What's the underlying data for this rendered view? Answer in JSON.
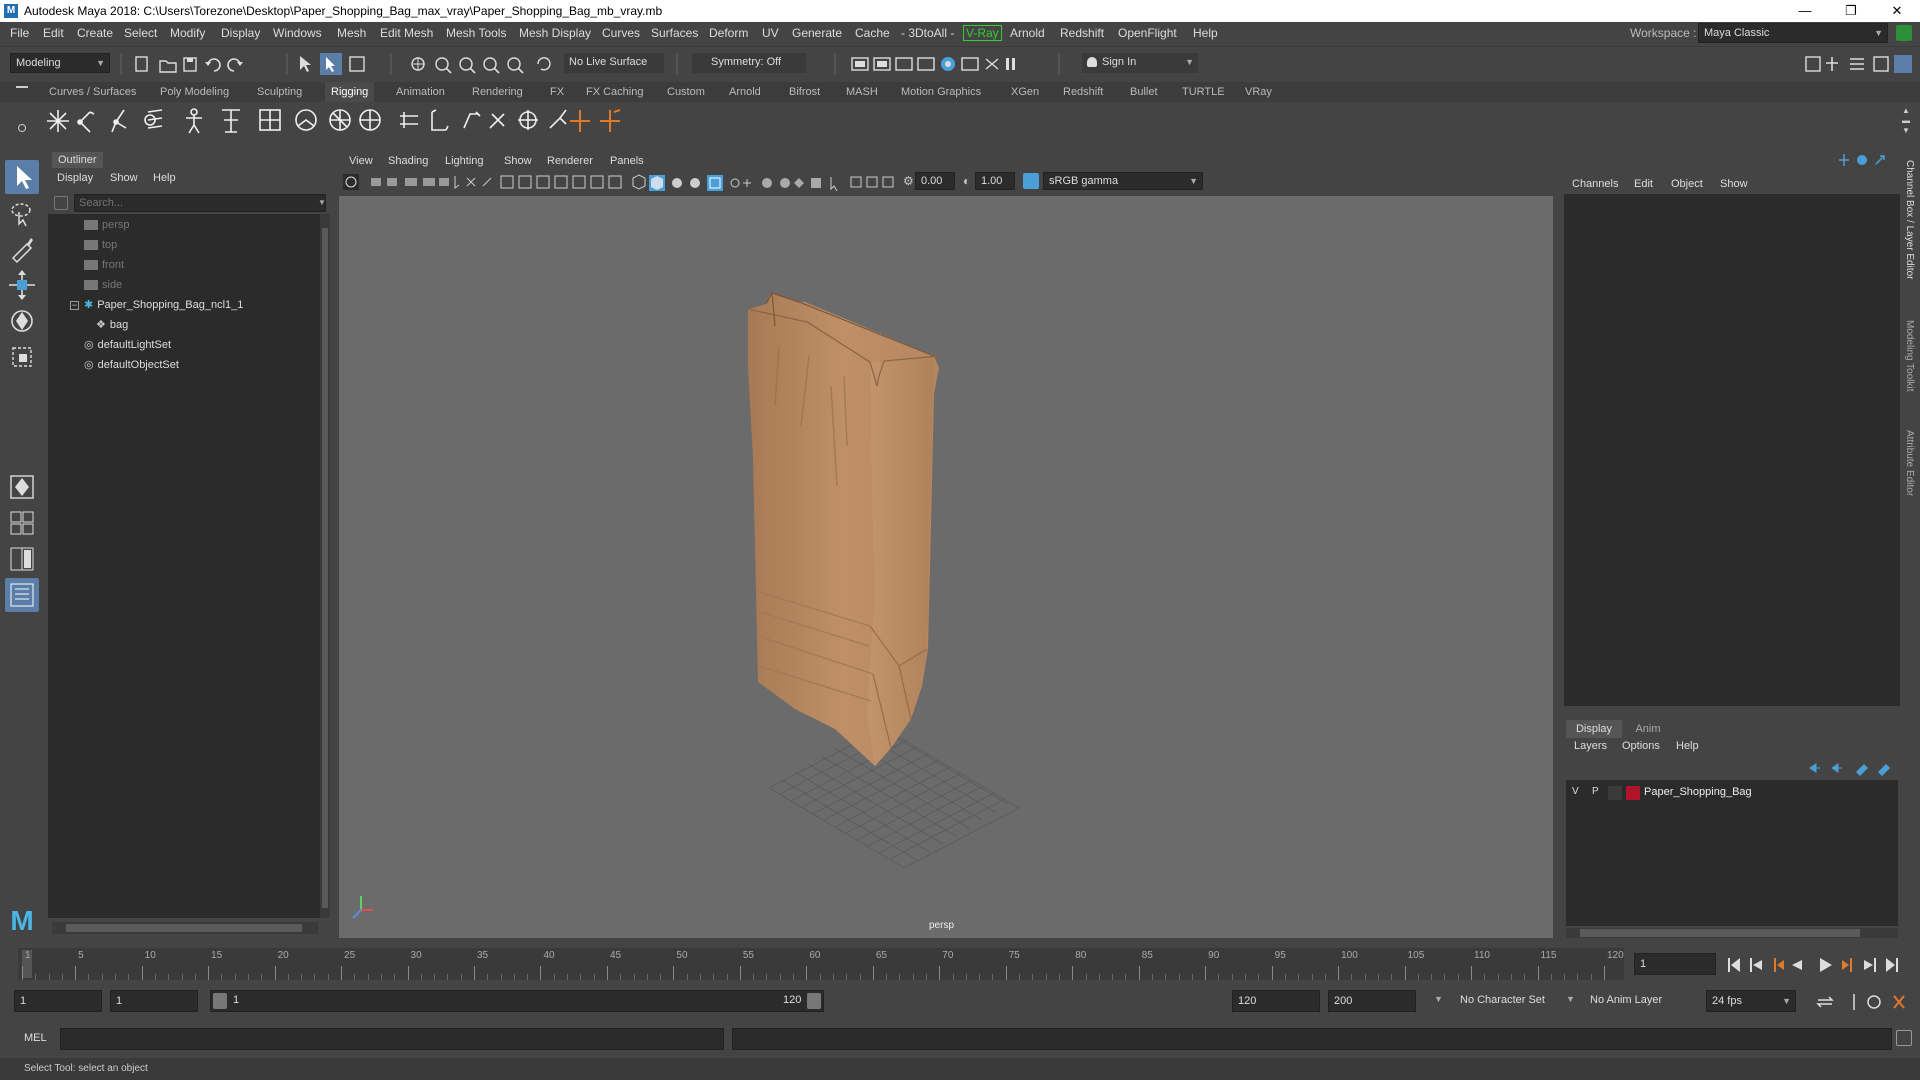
{
  "window": {
    "title": "Autodesk Maya 2018: C:\\Users\\Torezone\\Desktop\\Paper_Shopping_Bag_max_vray\\Paper_Shopping_Bag_mb_vray.mb",
    "logo_letter": "M",
    "minimize": "—",
    "restore": "❐",
    "close": "✕"
  },
  "menubar": {
    "items": [
      "File",
      "Edit",
      "Create",
      "Select",
      "Modify",
      "Display",
      "Windows",
      "Mesh",
      "Edit Mesh",
      "Mesh Tools",
      "Mesh Display",
      "Curves",
      "Surfaces",
      "Deform",
      "UV",
      "Generate",
      "Cache",
      "- 3DtoAll -",
      "V-Ray",
      "Arnold",
      "Redshift",
      "OpenFlight",
      "Help"
    ],
    "workspace_label": "Workspace :",
    "workspace_value": "Maya Classic"
  },
  "statusline": {
    "menuset": "Modeling",
    "live_surface": "No Live Surface",
    "symmetry": "Symmetry: Off",
    "sign_in": "Sign In"
  },
  "shelf": {
    "tabs": [
      "Curves / Surfaces",
      "Poly Modeling",
      "Sculpting",
      "Rigging",
      "Animation",
      "Rendering",
      "FX",
      "FX Caching",
      "Custom",
      "Arnold",
      "Bifrost",
      "MASH",
      "Motion Graphics",
      "XGen",
      "Redshift",
      "Bullet",
      "TURTLE",
      "VRay"
    ],
    "active_tab": "Rigging"
  },
  "outliner": {
    "tab": "Outliner",
    "menu": [
      "Display",
      "Show",
      "Help"
    ],
    "search_placeholder": "Search...",
    "items": [
      {
        "label": "persp",
        "dim": true
      },
      {
        "label": "top",
        "dim": true
      },
      {
        "label": "front",
        "dim": true
      },
      {
        "label": "side",
        "dim": true
      },
      {
        "label": "Paper_Shopping_Bag_ncl1_1",
        "dim": false
      },
      {
        "label": "bag",
        "dim": false
      },
      {
        "label": "defaultLightSet",
        "dim": false
      },
      {
        "label": "defaultObjectSet",
        "dim": false
      }
    ]
  },
  "viewport": {
    "menu": [
      "View",
      "Shading",
      "Lighting",
      "Show",
      "Renderer",
      "Panels"
    ],
    "near_value": "0.00",
    "far_value": "1.00",
    "color_space": "sRGB gamma",
    "camera_label": "persp"
  },
  "channelbox": {
    "menu": [
      "Channels",
      "Edit",
      "Object",
      "Show"
    ],
    "layer_tabs": [
      "Display",
      "Anim"
    ],
    "layer_menu": [
      "Layers",
      "Options",
      "Help"
    ],
    "layer": {
      "v": "V",
      "p": "P",
      "name": "Paper_Shopping_Bag",
      "color": "#b0142a"
    }
  },
  "side_tabs": [
    "Channel Box / Layer Editor",
    "Modeling Toolkit",
    "Attribute Editor"
  ],
  "timeline": {
    "ticks": [
      "1",
      "5",
      "10",
      "15",
      "20",
      "25",
      "30",
      "35",
      "40",
      "45",
      "50",
      "55",
      "60",
      "65",
      "70",
      "75",
      "80",
      "85",
      "90",
      "95",
      "100",
      "105",
      "110",
      "115",
      "120"
    ],
    "current_frame": "1"
  },
  "range": {
    "start": "1",
    "playback_start": "1",
    "slider_start": "1",
    "slider_end": "120",
    "playback_end": "120",
    "end": "200",
    "character_set": "No Character Set",
    "anim_layer": "No Anim Layer",
    "fps": "24 fps"
  },
  "cmdline": {
    "label": "MEL"
  },
  "helpline": {
    "text": "Select Tool: select an object"
  },
  "colors": {
    "accent": "#5a7ea8",
    "bag": "#b98a62",
    "viewport": "#6b6b6b"
  }
}
